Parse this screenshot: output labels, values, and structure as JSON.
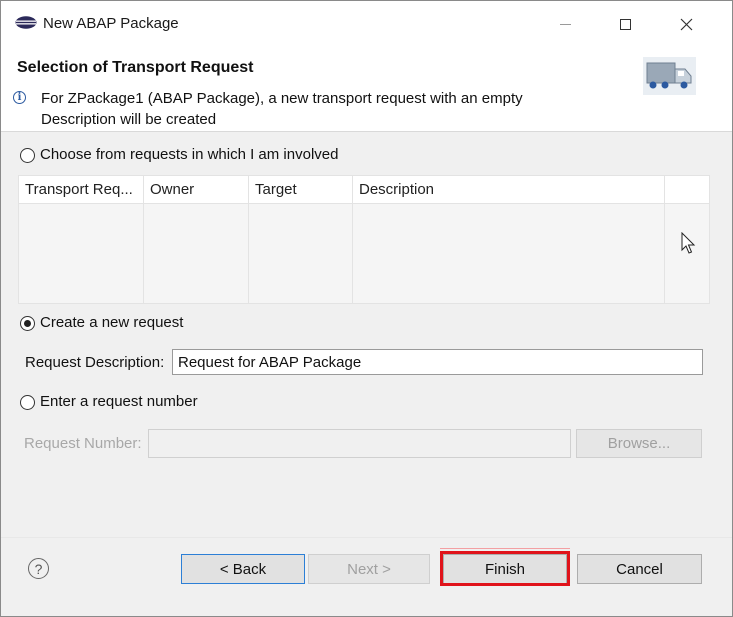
{
  "window": {
    "title": "New ABAP Package",
    "minimize_icon": "minimize-icon",
    "maximize_icon": "maximize-icon",
    "close_icon": "close-icon",
    "app_icon": "eclipse-icon"
  },
  "header": {
    "title": "Selection of Transport Request",
    "message": "For ZPackage1 (ABAP Package), a new transport request with an empty Description will be created",
    "info_icon": "info-icon",
    "banner_icon": "transport-truck-icon"
  },
  "options": {
    "choose_label": "Choose from requests in which I am involved",
    "create_label": "Create a new request",
    "enter_label": "Enter a request number",
    "selected": "create"
  },
  "table": {
    "columns": [
      "Transport Req...",
      "Owner",
      "Target",
      "Description"
    ],
    "rows": []
  },
  "create": {
    "description_label": "Request Description:",
    "description_value": "Request for ABAP Package"
  },
  "enter": {
    "number_label": "Request Number:",
    "number_value": "",
    "browse_label": "Browse..."
  },
  "footer": {
    "help_icon": "help-icon",
    "back_label": "< Back",
    "next_label": "Next >",
    "finish_label": "Finish",
    "cancel_label": "Cancel"
  },
  "colors": {
    "highlight": "#e0131b",
    "accent": "#2c7fd6"
  }
}
